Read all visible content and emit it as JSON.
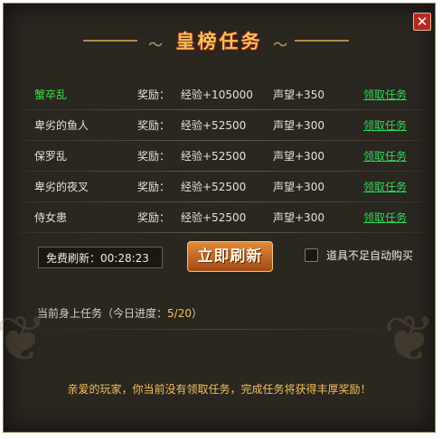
{
  "title": "皇榜任务",
  "close_glyph": "✕",
  "tasks": [
    {
      "name": "蟹卒乱",
      "reward_label": "奖励：",
      "exp": "经验+105000",
      "reputation": "声望+350",
      "action": "领取任务",
      "highlight": true
    },
    {
      "name": "卑劣的鱼人",
      "reward_label": "奖励：",
      "exp": "经验+52500",
      "reputation": "声望+300",
      "action": "领取任务",
      "highlight": false
    },
    {
      "name": "保罗乱",
      "reward_label": "奖励：",
      "exp": "经验+52500",
      "reputation": "声望+300",
      "action": "领取任务",
      "highlight": false
    },
    {
      "name": "卑劣的夜叉",
      "reward_label": "奖励：",
      "exp": "经验+52500",
      "reputation": "声望+300",
      "action": "领取任务",
      "highlight": false
    },
    {
      "name": "侍女患",
      "reward_label": "奖励：",
      "exp": "经验+52500",
      "reputation": "声望+300",
      "action": "领取任务",
      "highlight": false
    }
  ],
  "refresh": {
    "free_label": "免费刷新：",
    "timer": "00:28:23",
    "button_label": "立即刷新"
  },
  "auto_buy": {
    "label": "道具不足自动购买",
    "checked": false
  },
  "progress": {
    "label": "当前身上任务（今日进度：",
    "value": "5/20",
    "suffix": "）"
  },
  "footer_message": "亲爱的玩家，你当前没有领取任务，完成任务将获得丰厚奖励！",
  "colors": {
    "panel_bg": "#2a2620",
    "title_gold": "#f2c15a",
    "accept_green": "#2fd85a",
    "highlight_green": "#3fe03f",
    "close_red": "#b42a22"
  }
}
